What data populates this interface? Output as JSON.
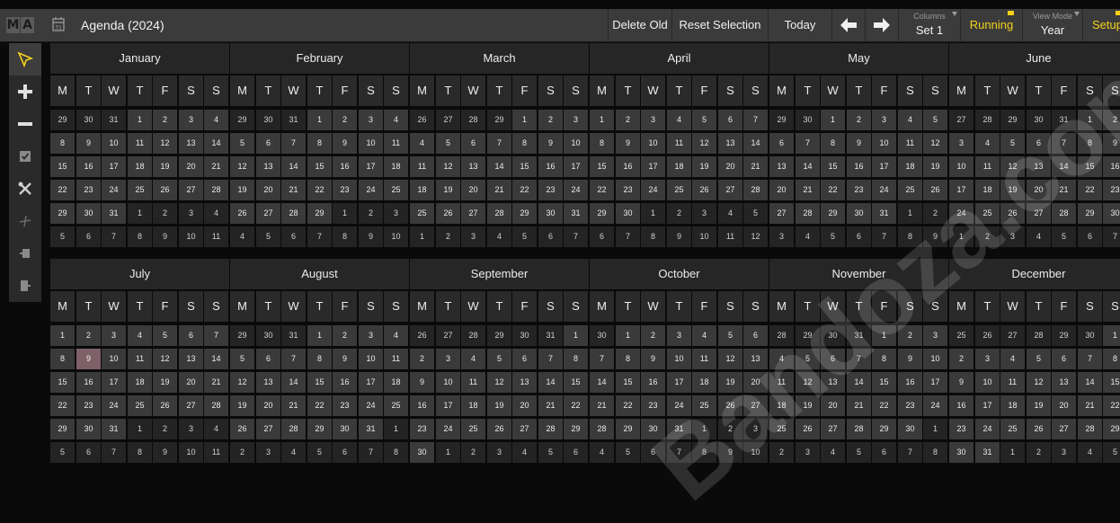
{
  "titlebar": {
    "logo": [
      "M",
      "A"
    ],
    "title": "Agenda (2024)",
    "delete_old": "Delete Old",
    "reset_selection": "Reset Selection",
    "today": "Today",
    "columns_label": "Columns",
    "columns_value": "Set 1",
    "running": "Running",
    "view_mode_label": "View Mode",
    "view_mode_value": "Year",
    "setup": "Setup",
    "accent_color": "#f5d21c"
  },
  "toolbar": {
    "tools": [
      "pointer-icon",
      "plus-icon",
      "minus-icon",
      "checkbox-icon",
      "tools-icon",
      "cut-icon",
      "clipboard-icon",
      "paste-icon"
    ]
  },
  "weekdays": [
    "M",
    "T",
    "W",
    "T",
    "F",
    "S",
    "S"
  ],
  "months": [
    {
      "name": "January",
      "rows": [
        [
          29,
          1
        ],
        [
          8,
          0
        ],
        [
          15,
          0
        ],
        [
          22,
          0
        ],
        [
          29,
          -3
        ],
        [
          5,
          -7
        ]
      ]
    },
    {
      "name": "February",
      "rows": [
        [
          29,
          3
        ],
        [
          5,
          0
        ],
        [
          12,
          0
        ],
        [
          19,
          0
        ],
        [
          26,
          -4
        ],
        [
          4,
          -7
        ]
      ]
    },
    {
      "name": "March",
      "rows": [
        [
          26,
          4
        ],
        [
          4,
          0
        ],
        [
          11,
          0
        ],
        [
          18,
          0
        ],
        [
          25,
          0
        ],
        [
          1,
          -7
        ]
      ]
    },
    {
      "name": "April",
      "rows": [
        [
          1,
          0
        ],
        [
          8,
          0
        ],
        [
          15,
          0
        ],
        [
          22,
          0
        ],
        [
          29,
          -2
        ],
        [
          6,
          -7
        ]
      ]
    },
    {
      "name": "May",
      "rows": [
        [
          29,
          2
        ],
        [
          6,
          0
        ],
        [
          13,
          0
        ],
        [
          20,
          0
        ],
        [
          27,
          -5
        ],
        [
          3,
          -7
        ]
      ]
    },
    {
      "name": "June",
      "rows": [
        [
          27,
          5
        ],
        [
          3,
          0
        ],
        [
          10,
          0
        ],
        [
          17,
          0
        ],
        [
          24,
          0
        ],
        [
          1,
          -7
        ]
      ]
    },
    {
      "name": "July",
      "rows": [
        [
          1,
          0
        ],
        [
          8,
          0
        ],
        [
          15,
          0
        ],
        [
          22,
          0
        ],
        [
          29,
          -3
        ],
        [
          5,
          -7
        ]
      ]
    },
    {
      "name": "August",
      "rows": [
        [
          29,
          3
        ],
        [
          5,
          0
        ],
        [
          12,
          0
        ],
        [
          19,
          0
        ],
        [
          26,
          -6
        ],
        [
          2,
          -7
        ]
      ]
    },
    {
      "name": "September",
      "rows": [
        [
          26,
          6
        ],
        [
          2,
          0
        ],
        [
          9,
          0
        ],
        [
          16,
          0
        ],
        [
          23,
          0
        ],
        [
          30,
          -1
        ]
      ]
    },
    {
      "name": "October",
      "rows": [
        [
          30,
          1
        ],
        [
          7,
          0
        ],
        [
          14,
          0
        ],
        [
          21,
          0
        ],
        [
          28,
          -4
        ],
        [
          4,
          -7
        ]
      ]
    },
    {
      "name": "November",
      "rows": [
        [
          28,
          4
        ],
        [
          4,
          0
        ],
        [
          11,
          0
        ],
        [
          18,
          0
        ],
        [
          25,
          -6
        ],
        [
          2,
          -7
        ]
      ]
    },
    {
      "name": "December",
      "rows": [
        [
          25,
          6
        ],
        [
          2,
          0
        ],
        [
          9,
          0
        ],
        [
          16,
          0
        ],
        [
          23,
          0
        ],
        [
          30,
          -2
        ]
      ]
    }
  ],
  "highlighted_day": {
    "month": "July",
    "day": 9
  },
  "watermark": "Bandoza.com"
}
